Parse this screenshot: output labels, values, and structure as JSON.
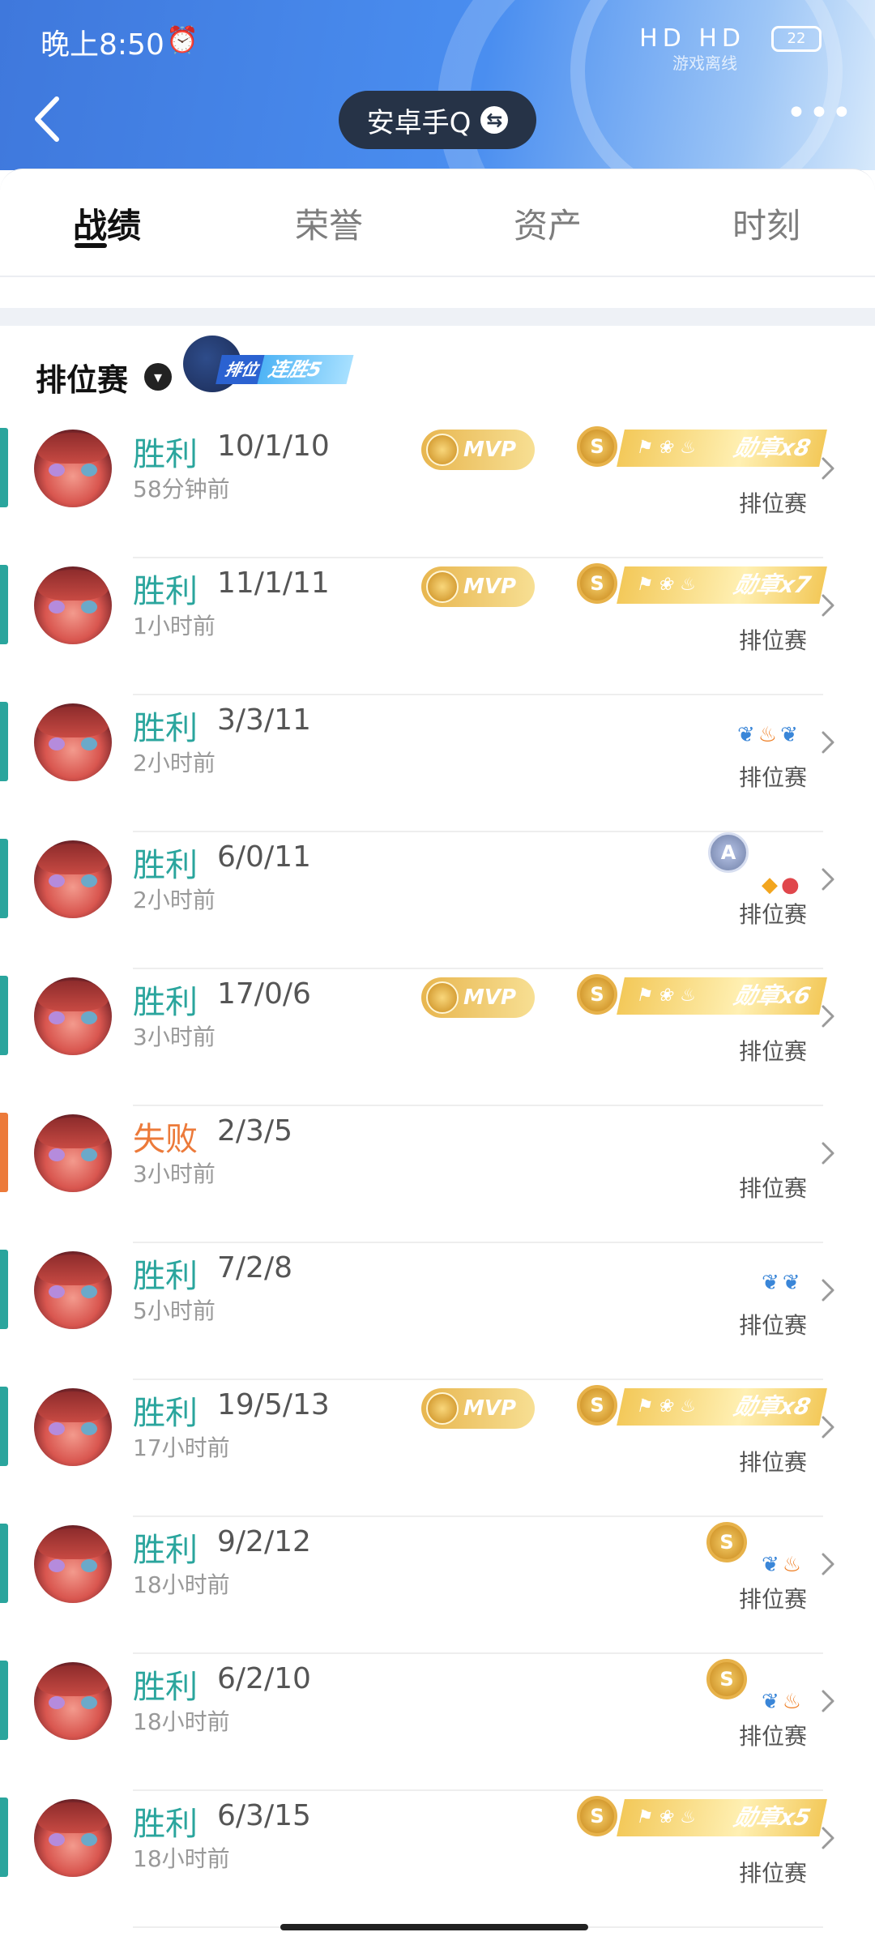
{
  "status_bar": {
    "time": "晚上8:50",
    "signals": "HD HD",
    "offline_label": "游戏离线",
    "battery": "22"
  },
  "header": {
    "title": "安卓手Q",
    "swap_icon": "⇆",
    "more_label": "•••"
  },
  "tabs": [
    {
      "label": "战绩",
      "active": true
    },
    {
      "label": "荣誉",
      "active": false
    },
    {
      "label": "资产",
      "active": false
    },
    {
      "label": "时刻",
      "active": false
    }
  ],
  "section": {
    "title": "排位赛",
    "streak_tag": "排位",
    "streak_text": "连胜5"
  },
  "matches": [
    {
      "result": "胜利",
      "kda": "10/1/10",
      "time": "58分钟前",
      "mode": "排位赛",
      "win": true,
      "mvp": true,
      "s": true,
      "medal": "勋章x8"
    },
    {
      "result": "胜利",
      "kda": "11/1/11",
      "time": "1小时前",
      "mode": "排位赛",
      "win": true,
      "mvp": true,
      "s": true,
      "medal": "勋章x7"
    },
    {
      "result": "胜利",
      "kda": "3/3/11",
      "time": "2小时前",
      "mode": "排位赛",
      "win": true
    },
    {
      "result": "胜利",
      "kda": "6/0/11",
      "time": "2小时前",
      "mode": "排位赛",
      "win": true,
      "rank_letter": "A"
    },
    {
      "result": "胜利",
      "kda": "17/0/6",
      "time": "3小时前",
      "mode": "排位赛",
      "win": true,
      "mvp": true,
      "s": true,
      "medal": "勋章x6"
    },
    {
      "result": "失败",
      "kda": "2/3/5",
      "time": "3小时前",
      "mode": "排位赛",
      "win": false
    },
    {
      "result": "胜利",
      "kda": "7/2/8",
      "time": "5小时前",
      "mode": "排位赛",
      "win": true
    },
    {
      "result": "胜利",
      "kda": "19/5/13",
      "time": "17小时前",
      "mode": "排位赛",
      "win": true,
      "mvp": true,
      "s": true,
      "medal": "勋章x8"
    },
    {
      "result": "胜利",
      "kda": "9/2/12",
      "time": "18小时前",
      "mode": "排位赛",
      "win": true,
      "s": true
    },
    {
      "result": "胜利",
      "kda": "6/2/10",
      "time": "18小时前",
      "mode": "排位赛",
      "win": true,
      "s": true
    },
    {
      "result": "胜利",
      "kda": "6/3/15",
      "time": "18小时前",
      "mode": "排位赛",
      "win": true,
      "s": true,
      "medal": "勋章x5"
    }
  ],
  "badge_text": {
    "mvp": "MVP",
    "s": "S"
  },
  "colors": {
    "win": "#2aa59d",
    "loss": "#ec7a3a",
    "header": "#4a8ef0"
  }
}
